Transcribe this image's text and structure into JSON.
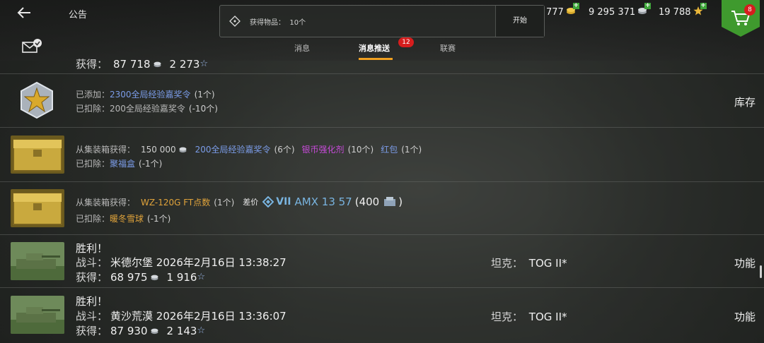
{
  "header": {
    "title": "公告",
    "search": {
      "label": "获得物品：",
      "value": "10个",
      "go_label": "开始"
    },
    "resources": [
      {
        "value": "777",
        "icon": "gold-icon"
      },
      {
        "value": "9 295 371",
        "icon": "silver-icon"
      },
      {
        "value": "19 788",
        "icon": "free-xp-icon"
      }
    ],
    "shop_badge": "8"
  },
  "tabs": [
    {
      "label": "消息"
    },
    {
      "label": "消息推送",
      "badge": "12"
    },
    {
      "label": "联赛"
    }
  ],
  "rows": [
    {
      "type": "partial",
      "label": "获得：",
      "silver": "87 718",
      "xp": "2 273"
    },
    {
      "type": "reward",
      "line1_label": "已添加：",
      "line1_item": "2300全局经验嘉奖令",
      "line1_qty": "(1个)",
      "line2_label": "已扣除：",
      "line2_item": "200全局经验嘉奖令",
      "line2_qty": "(-10个)",
      "side": "库存"
    },
    {
      "type": "box",
      "line1_label": "从集装箱获得：",
      "silver": "150 000",
      "item_a": "200全局经验嘉奖令",
      "qty_a": "(6个)",
      "item_b": "银币强化剂",
      "qty_b": "(10个)",
      "item_c": "红包",
      "qty_c": "(1个)",
      "line2_label": "已扣除：",
      "line2_item": "聚福盒",
      "line2_qty": "(-1个)"
    },
    {
      "type": "box2",
      "line1_label": "从集装箱获得：",
      "item_a": "WZ-120G FT点数",
      "qty_a": "(1个)",
      "diff_label": "差价",
      "tier": "VII",
      "tank": "AMX 13 57",
      "diff_value": "(400",
      "diff_close": ")",
      "line2_label": "已扣除：",
      "line2_item": "暖冬雪球",
      "line2_qty": "(-1个)"
    },
    {
      "type": "battle",
      "title": "胜利！",
      "battle_label": "战斗：",
      "map_time": "米德尔堡 2026年2月16日 13:38:27",
      "earn_label": "获得：",
      "silver": "68 975",
      "xp": "1 916",
      "tank_label": "坦克：",
      "tank": "TOG II*",
      "side": "功能"
    },
    {
      "type": "battle",
      "title": "胜利！",
      "battle_label": "战斗：",
      "map_time": "黄沙荒漠 2026年2月16日 13:36:07",
      "earn_label": "获得：",
      "silver": "87 930",
      "xp": "2 143",
      "tank_label": "坦克：",
      "tank": "TOG II*",
      "side": "功能"
    }
  ],
  "colors": {
    "accent": "#f0a020",
    "badge": "#d61d1d",
    "shop": "#3f9a2e",
    "link": "#7b9ce8"
  }
}
